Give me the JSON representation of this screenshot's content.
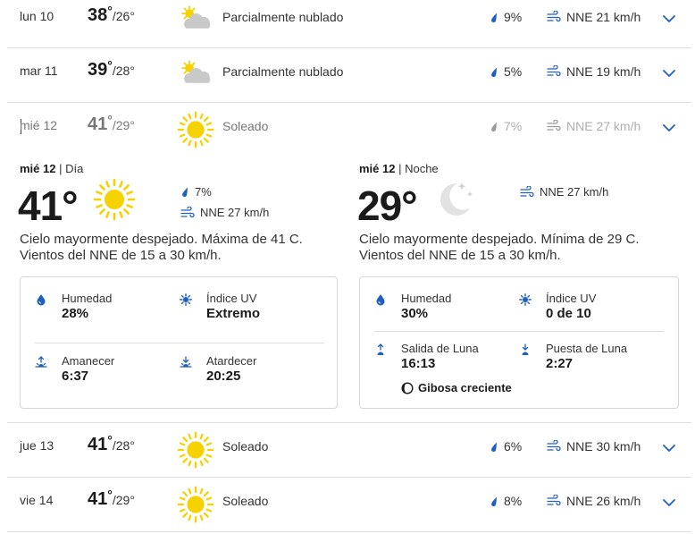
{
  "colors": {
    "accent": "#1f5fbf",
    "sun": "#f5d200",
    "cloud": "#c9c9c9"
  },
  "rows_top": [
    {
      "date": "lun 10",
      "hi": "38",
      "deg": "°",
      "lo": "/26°",
      "icon": "partly-cloudy-icon",
      "condition": "Parcialmente nublado",
      "precip": "9%",
      "wind": "NNE 21 km/h"
    },
    {
      "date": "mar 11",
      "hi": "39",
      "deg": "°",
      "lo": "/28°",
      "icon": "partly-cloudy-icon",
      "condition": "Parcialmente nublado",
      "precip": "5%",
      "wind": "NNE 19 km/h"
    },
    {
      "date": "mié 12",
      "hi": "41",
      "deg": "°",
      "lo": "/29°",
      "icon": "sun-icon",
      "condition": "Soleado",
      "precip": "7%",
      "wind": "NNE 27 km/h"
    }
  ],
  "detail": {
    "day": {
      "label": "mié 12",
      "part": " | Día",
      "temp": "41°",
      "precip": "7%",
      "wind": "NNE 27 km/h",
      "description": "Cielo mayormente despejado. Máxima de 41 C. Vientos del NNE de 15 a 30 km/h.",
      "humidity_label": "Humedad",
      "humidity": "28%",
      "uv_label": "Índice UV",
      "uv": "Extremo",
      "sunrise_label": "Amanecer",
      "sunrise": "6:37",
      "sunset_label": "Atardecer",
      "sunset": "20:25"
    },
    "night": {
      "label": "mié 12",
      "part": " | Noche",
      "temp": "29°",
      "wind": "NNE 27 km/h",
      "description": "Cielo mayormente despejado. Mínima de 29 C. Vientos del NNE de 15 a 30 km/h.",
      "humidity_label": "Humedad",
      "humidity": "30%",
      "uv_label": "Índice UV",
      "uv": "0 de 10",
      "moonrise_label": "Salida de Luna",
      "moonrise": "16:13",
      "moonset_label": "Puesta de Luna",
      "moonset": "2:27",
      "moon_phase": "Gibosa creciente"
    }
  },
  "rows_bottom": [
    {
      "date": "jue 13",
      "hi": "41",
      "deg": "°",
      "lo": "/28°",
      "icon": "sun-icon",
      "condition": "Soleado",
      "precip": "6%",
      "wind": "NNE 30 km/h"
    },
    {
      "date": "vie 14",
      "hi": "41",
      "deg": "°",
      "lo": "/29°",
      "icon": "sun-icon",
      "condition": "Soleado",
      "precip": "8%",
      "wind": "NNE 26 km/h"
    }
  ]
}
